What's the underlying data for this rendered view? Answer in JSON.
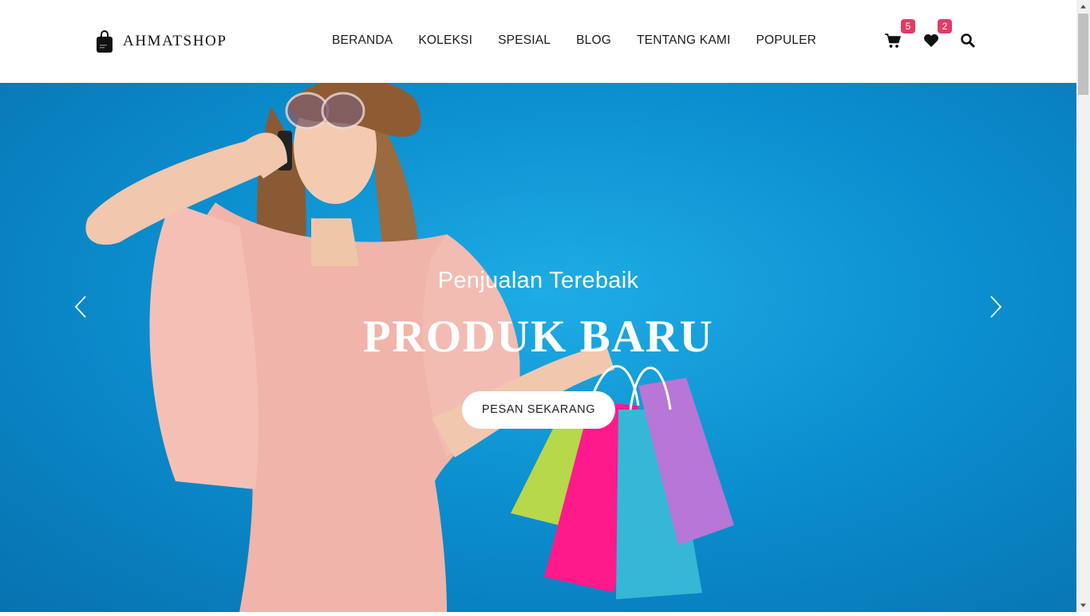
{
  "brand": {
    "name": "AHMATSHOP",
    "icon": "shopping-bag-icon"
  },
  "nav": {
    "items": [
      {
        "label": "BERANDA"
      },
      {
        "label": "KOLEKSI"
      },
      {
        "label": "SPESIAL"
      },
      {
        "label": "BLOG"
      },
      {
        "label": "TENTANG KAMI"
      },
      {
        "label": "POPULER"
      }
    ]
  },
  "header_icons": {
    "cart": {
      "icon": "cart-icon",
      "count": "5"
    },
    "wishlist": {
      "icon": "heart-icon",
      "count": "2"
    },
    "search": {
      "icon": "search-icon"
    }
  },
  "hero": {
    "subtitle": "Penjualan Terebaik",
    "title": "PRODUK BARU",
    "cta_label": "PESAN SEKARANG",
    "prev_icon": "chevron-left-icon",
    "next_icon": "chevron-right-icon"
  },
  "colors": {
    "badge": "#e13c65",
    "hero_background": "#0a8fd0",
    "text_dark": "#1c1c1c"
  }
}
